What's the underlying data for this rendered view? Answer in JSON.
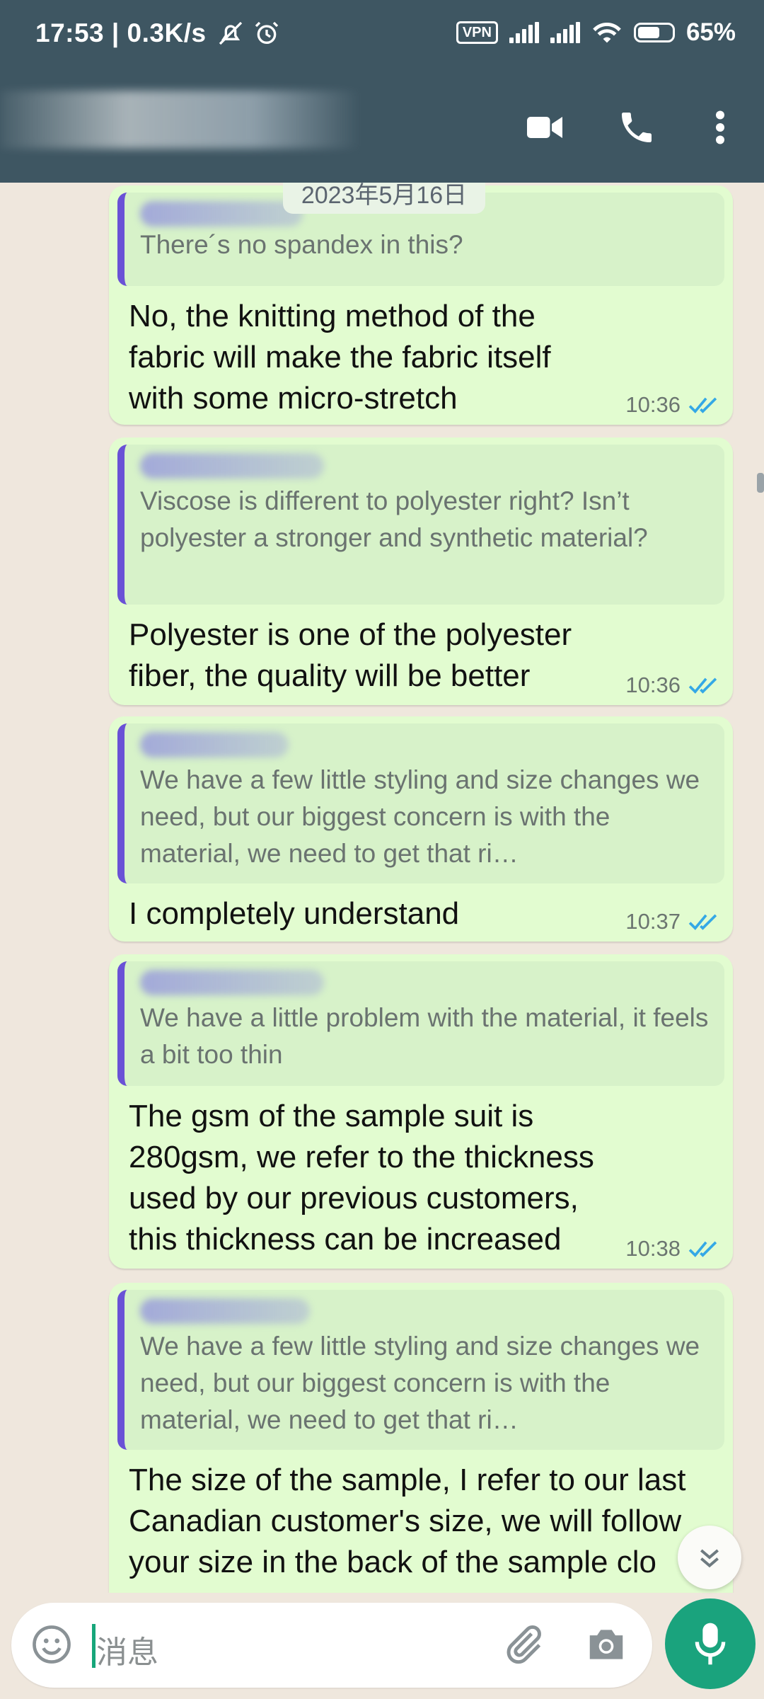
{
  "status_bar": {
    "time_speed": "17:53 | 0.3K/s",
    "vpn_label": "VPN",
    "battery_percent": "65%",
    "icons": [
      "mute-bell-icon",
      "alarm-icon",
      "vpn-icon",
      "signal-icon",
      "signal-icon",
      "wifi-icon",
      "battery-icon"
    ]
  },
  "header": {
    "actions": [
      "video-call-icon",
      "voice-call-icon",
      "more-vert-icon"
    ]
  },
  "chat": {
    "date_chip": "2023年5月16日",
    "messages": [
      {
        "quote": "There´s no spandex in this?",
        "text": "No, the knitting method of the fabric will make the fabric itself with some micro-stretch",
        "time": "10:36"
      },
      {
        "quote": "Viscose is different to polyester right? Isn’t polyester a stronger and synthetic material?",
        "text": "Polyester is one of the polyester fiber, the quality will be better",
        "time": "10:36"
      },
      {
        "quote": "We have a few little styling and size changes we need, but our biggest concern is with the material, we need to get that ri…",
        "text": "I completely understand",
        "time": "10:37"
      },
      {
        "quote": "We have a little problem with the material, it feels a bit too thin",
        "text": "The gsm of the sample suit is 280gsm, we refer to the thickness used by our previous customers, this thickness can be increased",
        "time": "10:38"
      },
      {
        "quote": "We have a few little styling and size changes we need, but our biggest concern is with the material, we need to get that ri…",
        "text": "The size of the sample, I refer to our last Canadian customer's size, we will follow your size in the back of the sample clo",
        "time": ""
      }
    ]
  },
  "composer": {
    "placeholder": "消息",
    "icons": [
      "emoji-icon",
      "attach-icon",
      "camera-icon",
      "mic-icon"
    ]
  },
  "colors": {
    "header_bg": "#3e5662",
    "outgoing_bubble": "#e2fcd0",
    "quote_bar": "#6a51d6",
    "read_ticks": "#34a8e6",
    "mic_button": "#1aa37d"
  }
}
